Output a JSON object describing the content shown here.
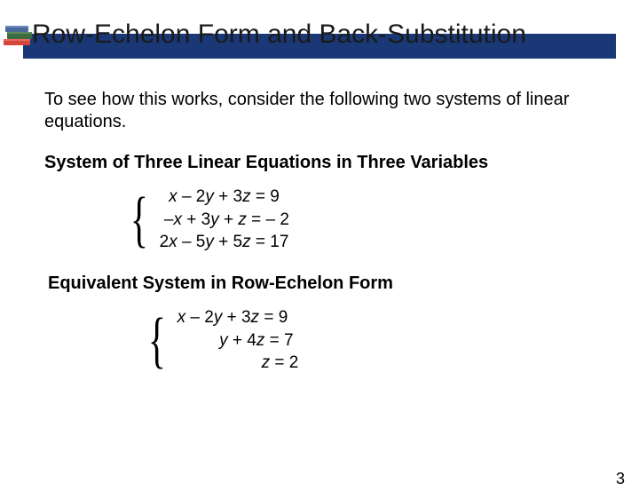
{
  "title": "Row-Echelon Form and Back-Substitution",
  "intro": "To see how this works, consider the following two systems of linear equations.",
  "system1": {
    "heading": "System of Three Linear Equations in Three Variables",
    "eq1_a": "  ",
    "eq1_b": "x",
    "eq1_c": " – 2",
    "eq1_d": "y",
    "eq1_e": " + 3",
    "eq1_f": "z",
    "eq1_g": " = 9",
    "eq2_a": " –",
    "eq2_b": "x",
    "eq2_c": " + 3",
    "eq2_d": "y",
    "eq2_e": " + ",
    "eq2_f": "z",
    "eq2_g": " = – 2",
    "eq3_a": "2",
    "eq3_b": "x",
    "eq3_c": " – 5",
    "eq3_d": "y",
    "eq3_e": " + 5",
    "eq3_f": "z",
    "eq3_g": " = 17"
  },
  "system2": {
    "heading": "Equivalent System in Row-Echelon Form",
    "eq1_a": "",
    "eq1_b": "x",
    "eq1_c": " – 2",
    "eq1_d": "y",
    "eq1_e": " + 3",
    "eq1_f": "z",
    "eq1_g": " = 9",
    "eq2_a": "         ",
    "eq2_b": "y",
    "eq2_c": " + 4",
    "eq2_d": "z",
    "eq2_e": " = 7",
    "eq3_a": "                  ",
    "eq3_b": "z",
    "eq3_c": " = 2"
  },
  "pageNumber": "3"
}
